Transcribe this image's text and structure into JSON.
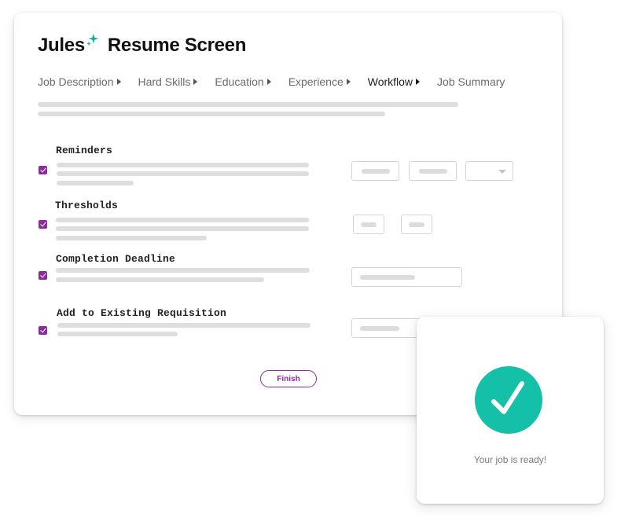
{
  "header": {
    "brand": "Jules",
    "title": "Resume Screen"
  },
  "tabs": [
    {
      "label": "Job Description",
      "active": false
    },
    {
      "label": "Hard Skills",
      "active": false
    },
    {
      "label": "Education",
      "active": false
    },
    {
      "label": "Experience",
      "active": false
    },
    {
      "label": "Workflow",
      "active": true
    },
    {
      "label": "Job Summary",
      "active": false
    }
  ],
  "sections": [
    {
      "label": "Reminders",
      "checked": true
    },
    {
      "label": "Thresholds",
      "checked": true
    },
    {
      "label": "Completion Deadline",
      "checked": true
    },
    {
      "label": "Add to Existing Requisition",
      "checked": true
    }
  ],
  "actions": {
    "finish_label": "Finish"
  },
  "notification": {
    "message": "Your job is ready!",
    "icon": "checkmark-icon"
  },
  "colors": {
    "accent": "#8e2a9f",
    "success": "#14c0a8",
    "sparkle": "#17a99b",
    "placeholder": "#dedede"
  }
}
